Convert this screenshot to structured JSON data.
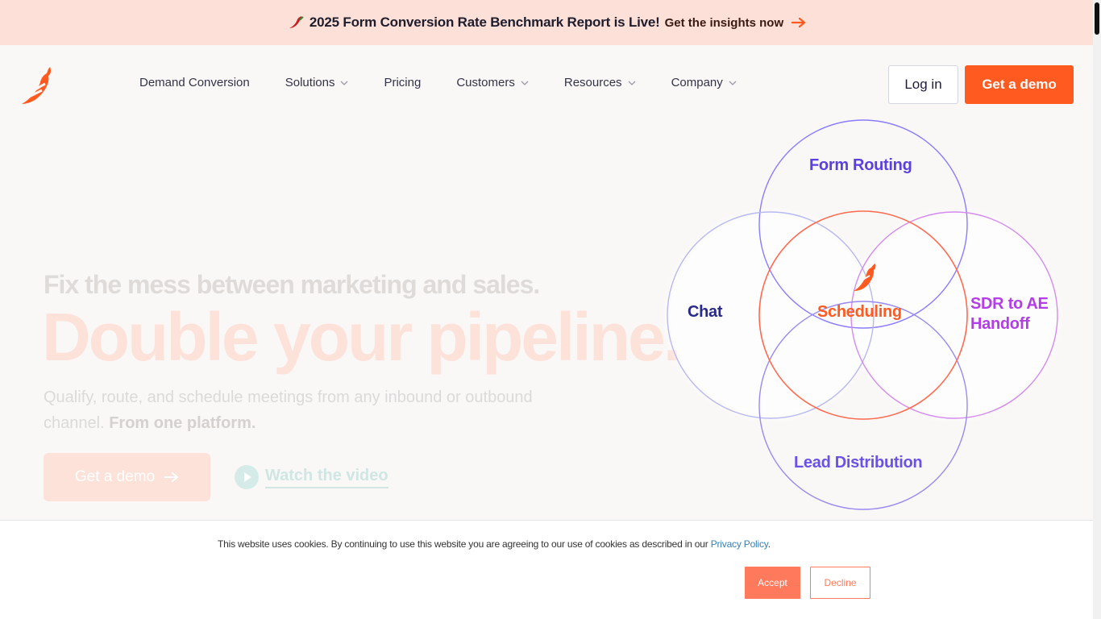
{
  "banner": {
    "text": "2025 Form Conversion Rate Benchmark Report is Live!",
    "link": "Get the insights now"
  },
  "nav": {
    "items": [
      {
        "label": "Demand Conversion",
        "dropdown": false
      },
      {
        "label": "Solutions",
        "dropdown": true
      },
      {
        "label": "Pricing",
        "dropdown": false
      },
      {
        "label": "Customers",
        "dropdown": true
      },
      {
        "label": "Resources",
        "dropdown": true
      },
      {
        "label": "Company",
        "dropdown": true
      }
    ],
    "login": "Log in",
    "demo": "Get a demo"
  },
  "hero": {
    "subtitle": "Fix the mess between marketing and sales.",
    "title": "Double your pipeline.",
    "description": "Qualify, route, and schedule meetings from any inbound or outbound channel.",
    "description_bold": "From one platform.",
    "cta": "Get a demo",
    "watch": "Watch the video"
  },
  "venn": {
    "top": "Form Routing",
    "left": "Chat",
    "center": "Scheduling",
    "right_line1": "SDR to AE",
    "right_line2": "Handoff",
    "bottom": "Lead Distribution"
  },
  "cookie": {
    "text": "This website uses cookies. By continuing to use this website you are agreeing to our use of cookies as described in our",
    "link": "Privacy Policy",
    "period": ".",
    "accept": "Accept",
    "decline": "Decline"
  },
  "colors": {
    "brand": "#ff5a1f",
    "banner_bg": "#fde0d7",
    "purple": "#5b3fe0",
    "navy": "#2a2a8a",
    "magenta": "#b33de6"
  },
  "icons": {
    "logo": "chili-pepper-logo",
    "banner": "chili-pepper-icon",
    "arrow": "arrow-right-icon",
    "dropdown": "chevron-down-icon",
    "play": "play-icon"
  }
}
